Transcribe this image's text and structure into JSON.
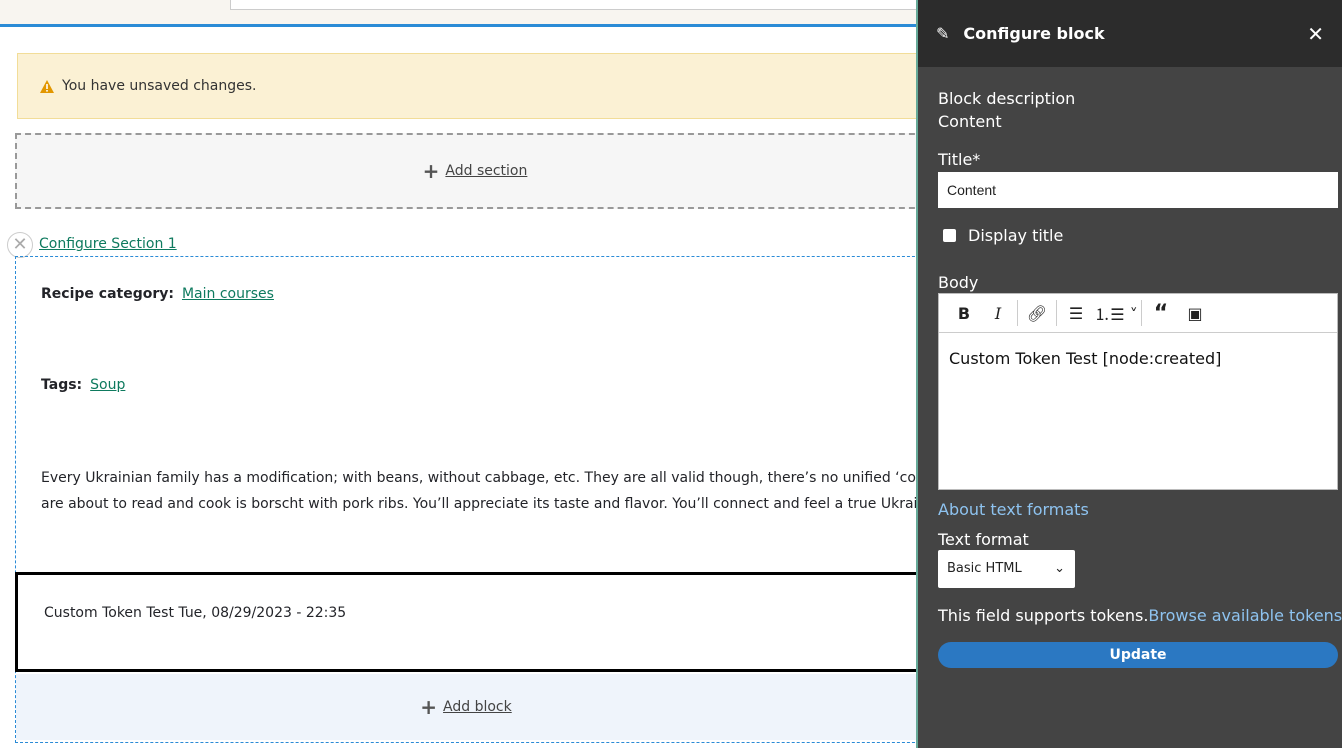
{
  "messages": {
    "warning": "You have unsaved changes."
  },
  "layout_builder": {
    "add_section": "Add section",
    "configure_section": "Configure Section 1",
    "recipe_category_label": "Recipe category:",
    "recipe_category_value": "Main courses",
    "tags_label": "Tags:",
    "tags_value": "Soup",
    "body_line1": "Every Ukrainian family has a modification; with beans, without cabbage, etc. They are all valid though, there’s no unified ‘correct’ rec",
    "body_line2": "are about to read and cook is borscht with pork ribs. You’ll appreciate its taste and flavor. You’ll connect and feel a true Ukrainian sou",
    "block_text": "Custom Token Test  Tue, 08/29/2023 - 22:35",
    "add_block": "Add block"
  },
  "panel": {
    "title": "Configure block",
    "block_description_label": "Block description",
    "block_description_value": "Content",
    "title_label": "Title*",
    "title_value": "Content",
    "display_title_label": "Display title",
    "body_label": "Body",
    "body_value": "Custom Token Test  [node:created]",
    "about_formats": "About text formats",
    "text_format_label": "Text format",
    "text_format_value": "Basic HTML",
    "tokens_text": "This field supports tokens.",
    "tokens_link": "Browse available tokens.",
    "update_button": "Update"
  }
}
